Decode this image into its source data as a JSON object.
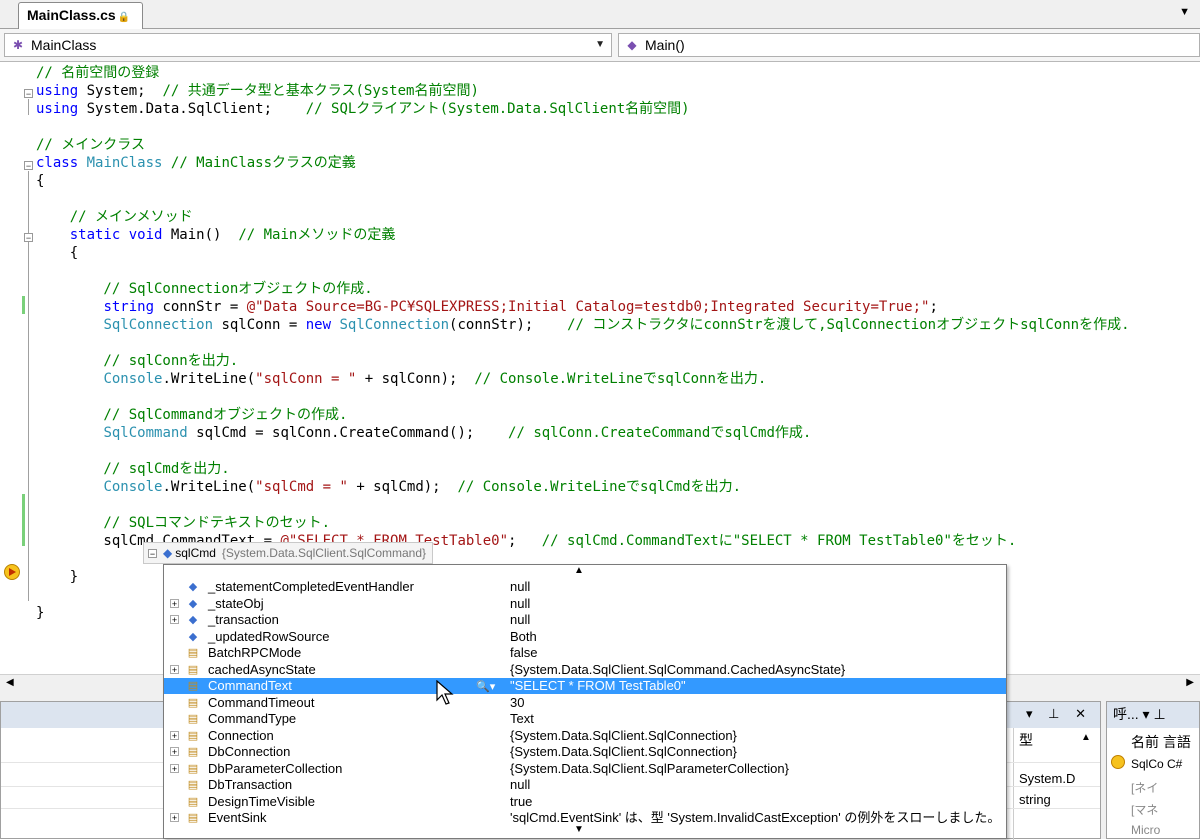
{
  "tab": {
    "title": "MainClass.cs"
  },
  "navbar": {
    "class_combo": "MainClass",
    "member_combo": "Main()"
  },
  "code": {
    "lines": [
      {
        "parts": [
          {
            "c": "cm",
            "t": "// 名前空間の登録"
          }
        ]
      },
      {
        "parts": [
          {
            "c": "kw",
            "t": "using"
          },
          {
            "c": "",
            "t": " System;  "
          },
          {
            "c": "cm",
            "t": "// 共通データ型と基本クラス(System名前空間)"
          }
        ]
      },
      {
        "parts": [
          {
            "c": "kw",
            "t": "using"
          },
          {
            "c": "",
            "t": " System.Data.SqlClient;    "
          },
          {
            "c": "cm",
            "t": "// SQLクライアント(System.Data.SqlClient名前空間)"
          }
        ]
      },
      {
        "parts": []
      },
      {
        "parts": [
          {
            "c": "cm",
            "t": "// メインクラス"
          }
        ]
      },
      {
        "parts": [
          {
            "c": "kw",
            "t": "class"
          },
          {
            "c": "",
            "t": " "
          },
          {
            "c": "ty",
            "t": "MainClass"
          },
          {
            "c": "",
            "t": " "
          },
          {
            "c": "cm",
            "t": "// MainClassクラスの定義"
          }
        ]
      },
      {
        "parts": [
          {
            "c": "",
            "t": "{"
          }
        ]
      },
      {
        "parts": []
      },
      {
        "parts": [
          {
            "c": "cm",
            "t": "    // メインメソッド"
          }
        ]
      },
      {
        "parts": [
          {
            "c": "",
            "t": "    "
          },
          {
            "c": "kw",
            "t": "static"
          },
          {
            "c": "",
            "t": " "
          },
          {
            "c": "kw",
            "t": "void"
          },
          {
            "c": "",
            "t": " Main()  "
          },
          {
            "c": "cm",
            "t": "// Mainメソッドの定義"
          }
        ]
      },
      {
        "parts": [
          {
            "c": "",
            "t": "    {"
          }
        ]
      },
      {
        "parts": []
      },
      {
        "parts": [
          {
            "c": "cm",
            "t": "        // SqlConnectionオブジェクトの作成."
          }
        ]
      },
      {
        "parts": [
          {
            "c": "",
            "t": "        "
          },
          {
            "c": "kw",
            "t": "string"
          },
          {
            "c": "",
            "t": " connStr = "
          },
          {
            "c": "st",
            "t": "@\"Data Source=BG-PC¥SQLEXPRESS;Initial Catalog=testdb0;Integrated Security=True;\""
          },
          {
            "c": "",
            "t": ";"
          }
        ]
      },
      {
        "parts": [
          {
            "c": "",
            "t": "        "
          },
          {
            "c": "ty",
            "t": "SqlConnection"
          },
          {
            "c": "",
            "t": " sqlConn = "
          },
          {
            "c": "kw",
            "t": "new"
          },
          {
            "c": "",
            "t": " "
          },
          {
            "c": "ty",
            "t": "SqlConnection"
          },
          {
            "c": "",
            "t": "(connStr);    "
          },
          {
            "c": "cm",
            "t": "// コンストラクタにconnStrを渡して,SqlConnectionオブジェクトsqlConnを作成."
          }
        ]
      },
      {
        "parts": []
      },
      {
        "parts": [
          {
            "c": "cm",
            "t": "        // sqlConnを出力."
          }
        ]
      },
      {
        "parts": [
          {
            "c": "",
            "t": "        "
          },
          {
            "c": "ty",
            "t": "Console"
          },
          {
            "c": "",
            "t": ".WriteLine("
          },
          {
            "c": "st",
            "t": "\"sqlConn = \""
          },
          {
            "c": "",
            "t": " + sqlConn);  "
          },
          {
            "c": "cm",
            "t": "// Console.WriteLineでsqlConnを出力."
          }
        ]
      },
      {
        "parts": []
      },
      {
        "parts": [
          {
            "c": "cm",
            "t": "        // SqlCommandオブジェクトの作成."
          }
        ]
      },
      {
        "parts": [
          {
            "c": "",
            "t": "        "
          },
          {
            "c": "ty",
            "t": "SqlCommand"
          },
          {
            "c": "",
            "t": " sqlCmd = sqlConn.CreateCommand();    "
          },
          {
            "c": "cm",
            "t": "// sqlConn.CreateCommandでsqlCmd作成."
          }
        ]
      },
      {
        "parts": []
      },
      {
        "parts": [
          {
            "c": "cm",
            "t": "        // sqlCmdを出力."
          }
        ]
      },
      {
        "parts": [
          {
            "c": "",
            "t": "        "
          },
          {
            "c": "ty",
            "t": "Console"
          },
          {
            "c": "",
            "t": ".WriteLine("
          },
          {
            "c": "st",
            "t": "\"sqlCmd = \""
          },
          {
            "c": "",
            "t": " + sqlCmd);  "
          },
          {
            "c": "cm",
            "t": "// Console.WriteLineでsqlCmdを出力."
          }
        ]
      },
      {
        "parts": []
      },
      {
        "parts": [
          {
            "c": "cm",
            "t": "        // SQLコマンドテキストのセット."
          }
        ]
      },
      {
        "parts": [
          {
            "c": "",
            "t": "        sqlCmd.CommandText = "
          },
          {
            "c": "st",
            "t": "@\"SELECT * FROM TestTable0\""
          },
          {
            "c": "",
            "t": ";   "
          },
          {
            "c": "cm",
            "t": "// sqlCmd.CommandTextに\"SELECT * FROM TestTable0\"をセット."
          }
        ]
      },
      {
        "parts": []
      },
      {
        "parts": [
          {
            "c": "",
            "t": "    }"
          }
        ]
      },
      {
        "parts": []
      },
      {
        "parts": [
          {
            "c": "",
            "t": "}"
          }
        ]
      }
    ]
  },
  "datatip": {
    "name": "sqlCmd",
    "type": "{System.Data.SqlClient.SqlCommand}"
  },
  "members": [
    {
      "name": "_statementCompletedEventHandler",
      "value": "null",
      "expand": false,
      "icon": "field"
    },
    {
      "name": "_stateObj",
      "value": "null",
      "expand": true,
      "icon": "field"
    },
    {
      "name": "_transaction",
      "value": "null",
      "expand": true,
      "icon": "field"
    },
    {
      "name": "_updatedRowSource",
      "value": "Both",
      "expand": false,
      "icon": "field"
    },
    {
      "name": "BatchRPCMode",
      "value": "false",
      "expand": false,
      "icon": "prop"
    },
    {
      "name": "cachedAsyncState",
      "value": "{System.Data.SqlClient.SqlCommand.CachedAsyncState}",
      "expand": true,
      "icon": "prop"
    },
    {
      "name": "CommandText",
      "value": "\"SELECT * FROM TestTable0\"",
      "expand": false,
      "icon": "prop",
      "selected": true
    },
    {
      "name": "CommandTimeout",
      "value": "30",
      "expand": false,
      "icon": "prop"
    },
    {
      "name": "CommandType",
      "value": "Text",
      "expand": false,
      "icon": "prop"
    },
    {
      "name": "Connection",
      "value": "{System.Data.SqlClient.SqlConnection}",
      "expand": true,
      "icon": "prop"
    },
    {
      "name": "DbConnection",
      "value": "{System.Data.SqlClient.SqlConnection}",
      "expand": true,
      "icon": "prop"
    },
    {
      "name": "DbParameterCollection",
      "value": "{System.Data.SqlClient.SqlParameterCollection}",
      "expand": true,
      "icon": "prop"
    },
    {
      "name": "DbTransaction",
      "value": "null",
      "expand": false,
      "icon": "prop"
    },
    {
      "name": "DesignTimeVisible",
      "value": "true",
      "expand": false,
      "icon": "prop"
    },
    {
      "name": "EventSink",
      "value": "'sqlCmd.EventSink' は、型 'System.InvalidCastException' の例外をスローしました。",
      "expand": true,
      "icon": "prop"
    }
  ],
  "panel1": {
    "type_header": "型",
    "rows": [
      "System.D",
      "string"
    ]
  },
  "panel2": {
    "title": "呼...",
    "name_header": "名前 言語",
    "rows": [
      "SqlCo C#",
      "[ネイ",
      "[マネ",
      "Micro"
    ]
  },
  "colors": {
    "keyword": "#0000ff",
    "type": "#2b91af",
    "comment": "#008000",
    "string": "#a31515",
    "selection": "#3399ff"
  }
}
